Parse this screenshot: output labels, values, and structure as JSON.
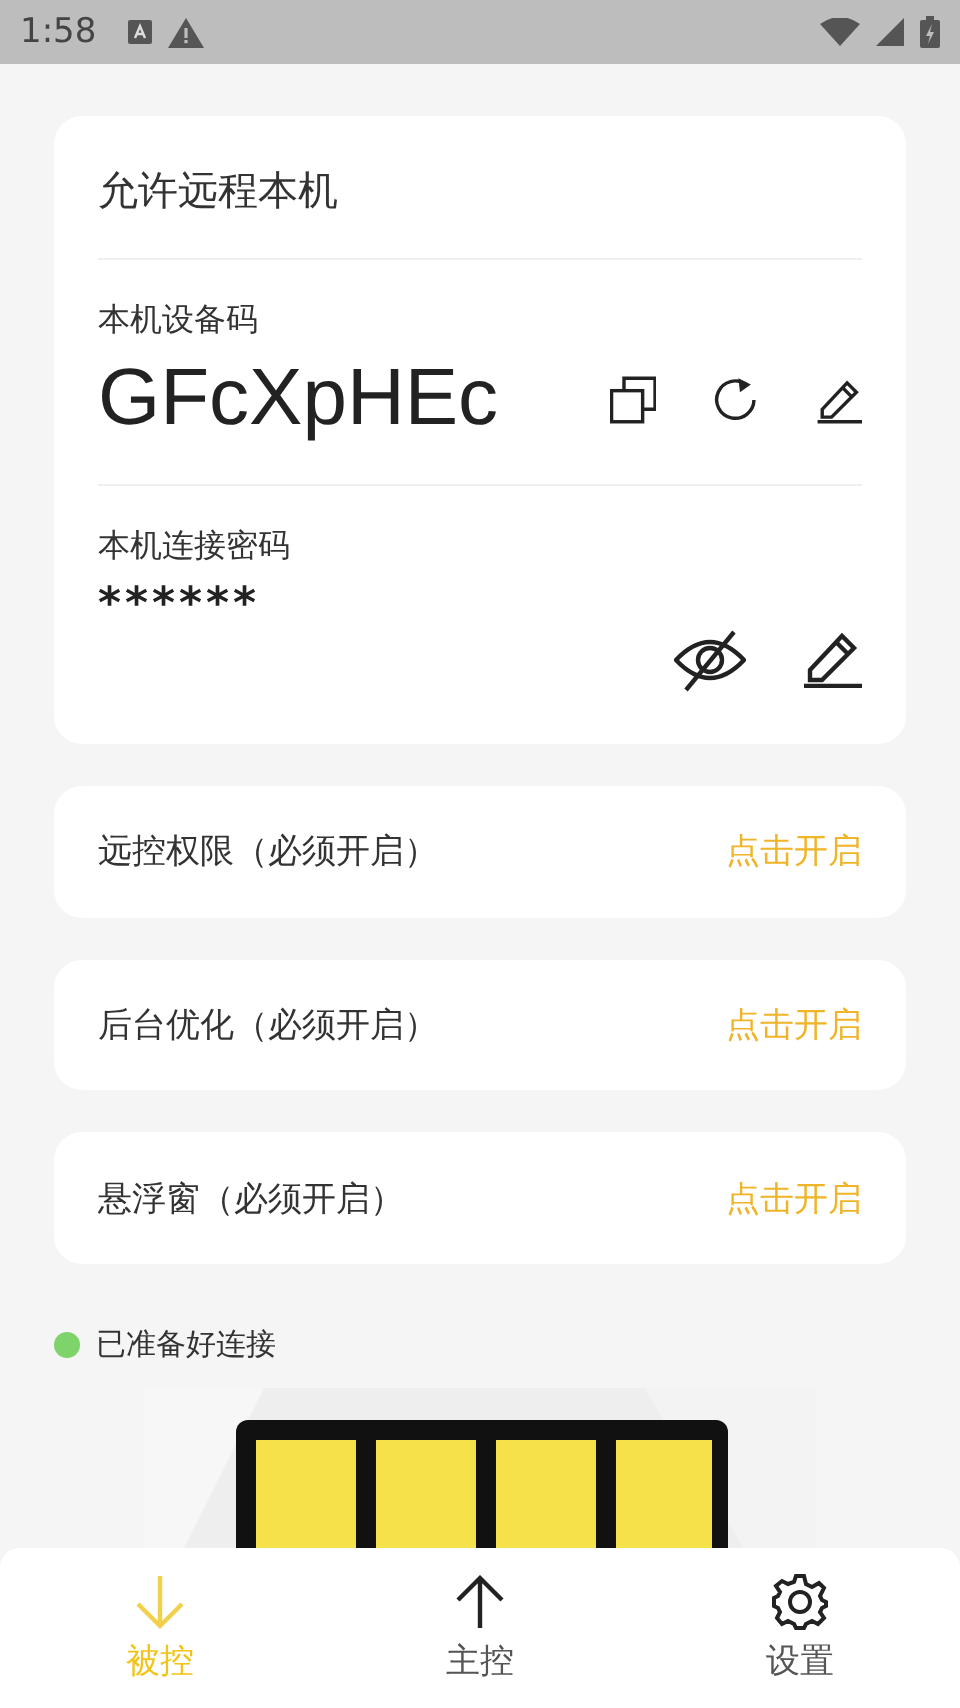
{
  "status_bar": {
    "time": "1:58"
  },
  "remote_card": {
    "title": "允许远程本机",
    "device_code_label": "本机设备码",
    "device_code": "GFcXpHEc",
    "password_label": "本机连接密码",
    "password": "******"
  },
  "permissions": [
    {
      "label": "远控权限（必须开启）",
      "action": "点击开启"
    },
    {
      "label": "后台优化（必须开启）",
      "action": "点击开启"
    },
    {
      "label": "悬浮窗（必须开启）",
      "action": "点击开启"
    }
  ],
  "connection_status": {
    "text": "已准备好连接",
    "color": "#7ed36a"
  },
  "bottom_nav": [
    {
      "label": "被控",
      "kind": "down",
      "selected": true
    },
    {
      "label": "主控",
      "kind": "up",
      "selected": false
    },
    {
      "label": "设置",
      "kind": "gear",
      "selected": false
    }
  ]
}
